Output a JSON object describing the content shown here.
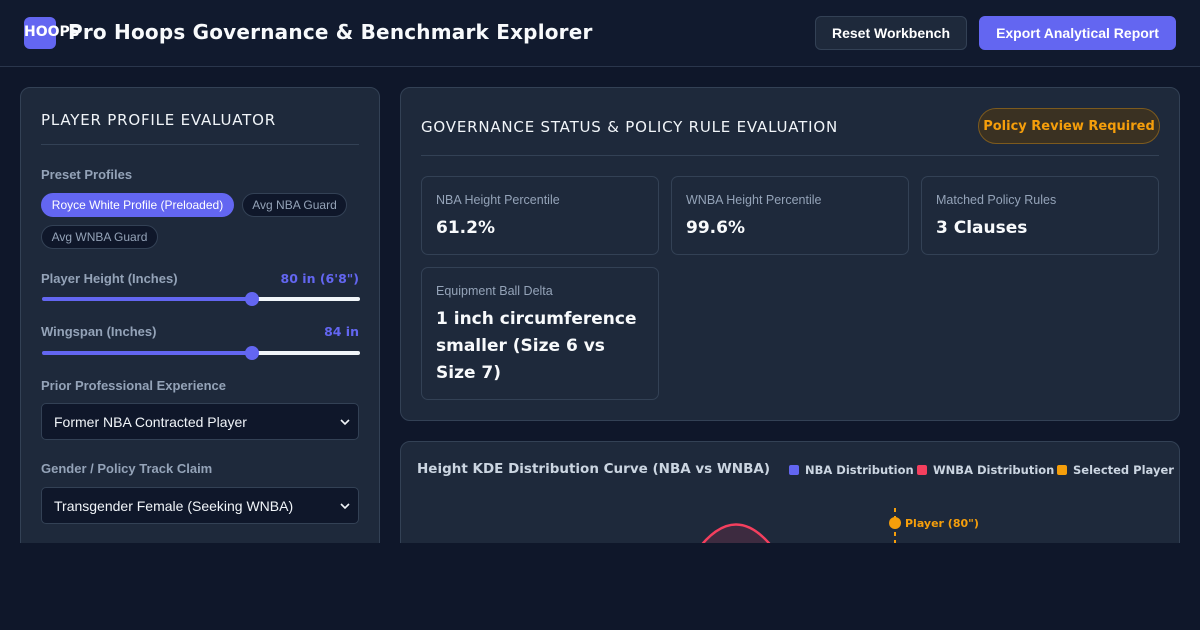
{
  "header": {
    "logo_text": "HOOPS",
    "title": "Pro Hoops Governance & Benchmark Explorer",
    "reset_label": "Reset Workbench",
    "export_label": "Export Analytical Report"
  },
  "evaluator": {
    "heading": "PLAYER PROFILE EVALUATOR",
    "presets_label": "Preset Profiles",
    "presets": [
      {
        "label": "Royce White Profile (Preloaded)",
        "active": true
      },
      {
        "label": "Avg NBA Guard",
        "active": false
      },
      {
        "label": "Avg WNBA Guard",
        "active": false
      }
    ],
    "height": {
      "label": "Player Height (Inches)",
      "value_text": "80 in (6'8\")",
      "level_fraction": 0.66
    },
    "wingspan": {
      "label": "Wingspan (Inches)",
      "value_text": "84 in",
      "level_fraction": 0.66
    },
    "experience": {
      "label": "Prior Professional Experience",
      "selected": "Former NBA Contracted Player"
    },
    "gender": {
      "label": "Gender / Policy Track Claim",
      "selected": "Transgender Female (Seeking WNBA)"
    }
  },
  "governance": {
    "heading": "GOVERNANCE STATUS & POLICY RULE EVALUATION",
    "status_badge": "Policy Review Required",
    "cards": [
      {
        "label": "NBA Height Percentile",
        "value": "61.2%"
      },
      {
        "label": "WNBA Height Percentile",
        "value": "99.6%"
      },
      {
        "label": "Matched Policy Rules",
        "value": "3 Clauses"
      },
      {
        "label": "Equipment Ball Delta",
        "value": "1 inch circumference smaller (Size 6 vs Size 7)"
      }
    ]
  },
  "chart": {
    "title": "Height KDE Distribution Curve (NBA vs WNBA)",
    "legend": [
      {
        "label": "NBA Distribution",
        "color": "#6366f1"
      },
      {
        "label": "WNBA Distribution",
        "color": "#f43f5e"
      },
      {
        "label": "Selected Player",
        "color": "#f59e0b"
      }
    ],
    "marker_label": "Player (80\")"
  },
  "colors": {
    "accent": "#6366f1",
    "warning": "#f59e0b",
    "wnba": "#f43f5e",
    "background": "#0f172a",
    "panel": "#1e293b"
  }
}
